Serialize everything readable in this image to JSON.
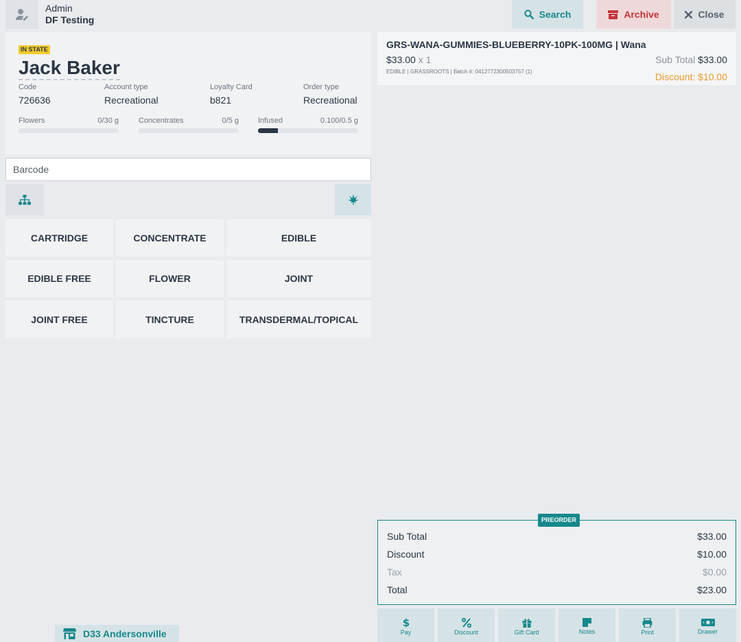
{
  "header": {
    "user_role": "Admin",
    "user_store": "DF Testing",
    "search_label": "Search",
    "archive_label": "Archive",
    "close_label": "Close"
  },
  "customer": {
    "state_badge": "IN STATE",
    "name": "Jack Baker",
    "fields": [
      {
        "label": "Code",
        "value": "726636"
      },
      {
        "label": "Account type",
        "value": "Recreational"
      },
      {
        "label": "Loyalty Card",
        "value": "b821"
      },
      {
        "label": "Order type",
        "value": "Recreational"
      }
    ],
    "limits": [
      {
        "label": "Flowers",
        "value": "0/30 g",
        "fill": 0.0
      },
      {
        "label": "Concentrates",
        "value": "0/5 g",
        "fill": 0.0
      },
      {
        "label": "Infused",
        "value": "0.100/0.5 g",
        "fill": 0.2
      }
    ]
  },
  "barcode": {
    "placeholder": "Barcode"
  },
  "categories": [
    "CARTRIDGE",
    "CONCENTRATE",
    "EDIBLE",
    "EDIBLE FREE",
    "FLOWER",
    "JOINT",
    "JOINT FREE",
    "TINCTURE",
    "TRANSDERMAL/TOPICAL"
  ],
  "cart": {
    "item_title": "GRS-WANA-GUMMIES-BLUEBERRY-10PK-100MG | Wana",
    "item_price": "$33.00",
    "item_qty": "x 1",
    "item_meta": "EDIBLE | GRASSROOTS | Batch #: 0412772300503757 (1)",
    "subtotal_label": "Sub Total",
    "subtotal_value": "$33.00",
    "discount_text": "Discount: $10.00"
  },
  "totals": {
    "badge": "PREORDER",
    "rows": [
      {
        "label": "Sub Total",
        "value": "$33.00"
      },
      {
        "label": "Discount",
        "value": "$10.00"
      },
      {
        "label": "Tax",
        "value": "$0.00"
      },
      {
        "label": "Total",
        "value": "$23.00"
      }
    ]
  },
  "actions": [
    {
      "label": "Pay",
      "icon": "dollar-icon"
    },
    {
      "label": "Discount",
      "icon": "percent-icon"
    },
    {
      "label": "Gift Card",
      "icon": "gift-icon"
    },
    {
      "label": "Notes",
      "icon": "note-icon"
    },
    {
      "label": "Print",
      "icon": "printer-icon"
    },
    {
      "label": "Drawer",
      "icon": "cash-drawer-icon"
    }
  ],
  "store": {
    "name": "D33 Andersonville"
  },
  "colors": {
    "accent": "#16888c",
    "danger": "#c5343a",
    "warning": "#ea9a2a",
    "badge": "#f2cb2e"
  }
}
